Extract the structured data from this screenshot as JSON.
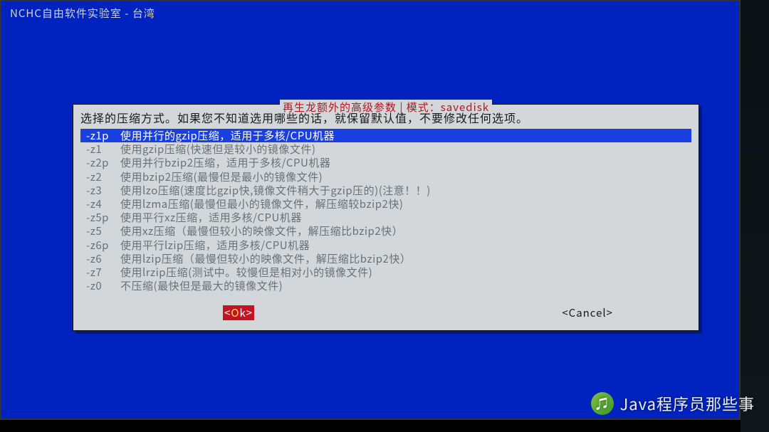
{
  "header": {
    "title": "NCHC自由软件实验室 - 台湾"
  },
  "dialog": {
    "title_prefix": "再生龙额外的高级参数 | 模式：",
    "title_mode": "savedisk",
    "prompt": "选择的压缩方式。如果您不知道选用哪些的话，就保留默认值，不要修改任何选项。",
    "ok_label": "<Ok>",
    "cancel_label": "<Cancel>",
    "selected_index": 0,
    "options": [
      {
        "flag": "-z1p",
        "desc": "使用并行的gzip压缩，适用于多核/CPU机器"
      },
      {
        "flag": "-z1",
        "desc": "使用gzip压缩(快速但是较小的镜像文件)"
      },
      {
        "flag": "-z2p",
        "desc": "使用并行bzip2压缩，适用于多核/CPU机器"
      },
      {
        "flag": "-z2",
        "desc": "使用bzip2压缩(最慢但是最小的镜像文件)"
      },
      {
        "flag": "-z3",
        "desc": "使用lzo压缩(速度比gzip快,镜像文件稍大于gzip压的)(注意！！)"
      },
      {
        "flag": "-z4",
        "desc": "使用lzma压缩(最慢但最小的镜像文件，解压缩较bzip2快)"
      },
      {
        "flag": "-z5p",
        "desc": "使用平行xz压缩，适用多核/CPU机器"
      },
      {
        "flag": "-z5",
        "desc": "使用xz压缩（最慢但较小的映像文件，解压缩比bzip2快）"
      },
      {
        "flag": "-z6p",
        "desc": "使用平行lzip压缩，适用多核/CPU机器"
      },
      {
        "flag": "-z6",
        "desc": "使用lzip压缩（最慢但较小的映像文件，解压缩比bzip2快）"
      },
      {
        "flag": "-z7",
        "desc": "使用lrzip压缩(测试中。较慢但是相对小的镜像文件)"
      },
      {
        "flag": "-z0",
        "desc": "不压缩(最快但是最大的镜像文件)"
      }
    ]
  },
  "watermark": {
    "text": "Java程序员那些事",
    "icon_glyph": "♫"
  }
}
